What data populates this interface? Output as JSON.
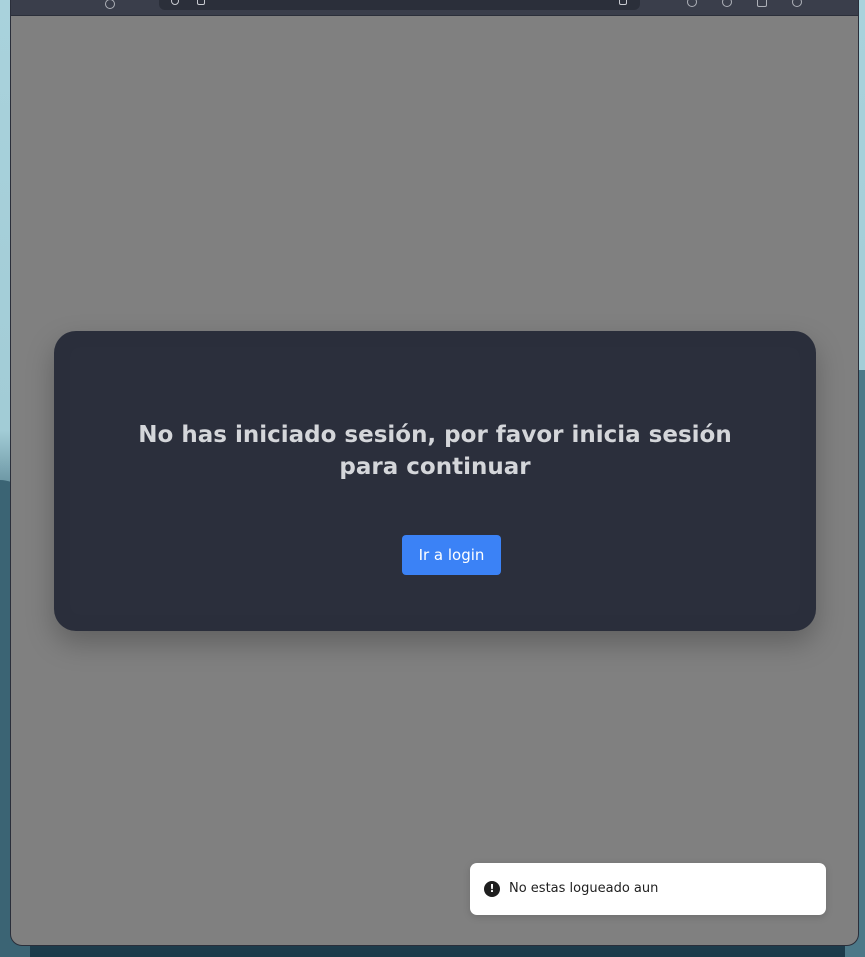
{
  "modal": {
    "title": "No has iniciado sesión, por favor inicia sesión para continuar",
    "login_button_label": "Ir a login"
  },
  "toast": {
    "icon": "exclamation-circle-icon",
    "icon_glyph": "!",
    "message": "No estas logueado aun"
  },
  "colors": {
    "overlay_background": "#808080",
    "card_background": "#2a2e3b",
    "button_accent": "#3b82f6",
    "toast_background": "#ffffff",
    "title_text": "#d4d6da"
  }
}
